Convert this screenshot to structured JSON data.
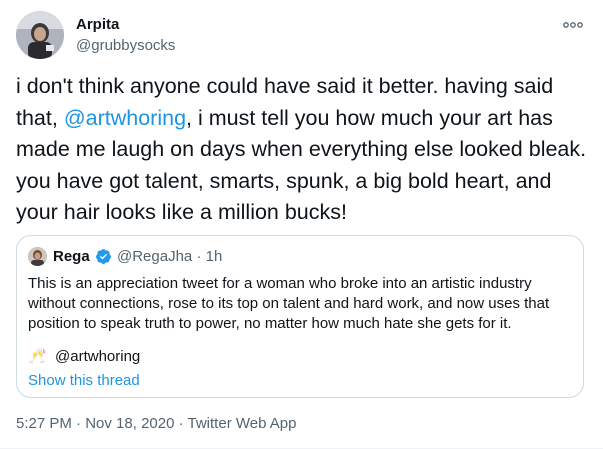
{
  "tweet": {
    "author": {
      "name": "Arpita",
      "handle": "@grubbysocks"
    },
    "body": {
      "part1": "i don't think anyone could have said it better. having said that, ",
      "mention": "@artwhoring",
      "part2": ", i must tell you how much your art has made me laugh on days when everything else looked bleak. you have got talent, smarts, spunk, a big bold heart, and your hair looks like a million bucks!"
    },
    "quoted": {
      "name": "Rega",
      "handle": "@RegaJha",
      "separator": "·",
      "time": "1h",
      "text": "This is an appreciation tweet for a woman who broke into an artistic industry without connections, rose to its top on talent and hard work, and now uses that position to speak truth to power, no matter how much hate she gets for it.",
      "emoji": "🥂",
      "mention": "@artwhoring",
      "show_thread": "Show this thread"
    },
    "meta": {
      "time": "5:27 PM",
      "sep1": " · ",
      "date": "Nov 18, 2020",
      "sep2": " · ",
      "client": "Twitter Web App"
    }
  },
  "colors": {
    "link": "#1b95e0",
    "muted": "#536471",
    "text": "#0f1419",
    "border": "#cfd9de",
    "verified": "#1d9bf0"
  },
  "icons": {
    "more": "more-horizontal-icon",
    "verified": "verified-badge-icon"
  }
}
